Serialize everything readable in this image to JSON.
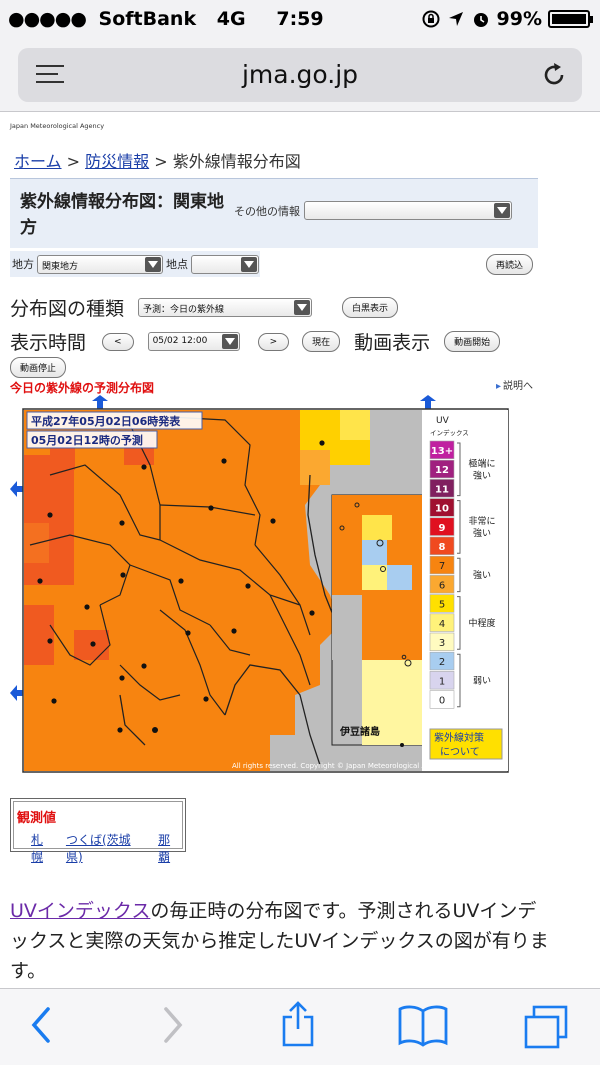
{
  "status": {
    "carrier": "SoftBank",
    "network": "4G",
    "time": "7:59",
    "battery_pct": "99%",
    "battery_fill": 0.99
  },
  "browser": {
    "host": "jma.go.jp"
  },
  "page": {
    "agency": "Japan Meteorological Agency",
    "breadcrumb": {
      "home": "ホーム",
      "sep1": " > ",
      "disaster": "防災情報",
      "sep2": " > ",
      "current": "紫外線情報分布図"
    },
    "title": "紫外線情報分布図：関東地方",
    "other_info_label": "その他の情報",
    "other_info_value": "",
    "region_label": "地方",
    "region_value": "関東地方",
    "point_label": "地点",
    "point_value": "",
    "reread": "再読込",
    "map_type_label": "分布図の種類",
    "map_type_value": "予測：今日の紫外線",
    "bw": "白黒表示",
    "time_label": "表示時間",
    "prev": "<",
    "time_value": "05/02 12:00",
    "next": ">",
    "now": "現在",
    "anim_label": "動画表示",
    "anim_start": "動画開始",
    "anim_stop": "動画停止",
    "map_title": "今日の紫外線の予測分布図",
    "explain": "説明へ",
    "map": {
      "issued": "平成27年05月02日06時発表",
      "forecast": "05月02日12時の予測",
      "islands": "伊豆諸島",
      "copyright": "All rights reserved. Copyright © Japan Meteorological Agency",
      "legend_title": "UV",
      "legend_sub": "インデックス",
      "legend": [
        {
          "label": "13+",
          "color": "#c020a0"
        },
        {
          "label": "12",
          "color": "#a0207f"
        },
        {
          "label": "11",
          "color": "#80205f"
        },
        {
          "label": "10",
          "color": "#a01030"
        },
        {
          "label": "9",
          "color": "#e01020"
        },
        {
          "label": "8",
          "color": "#f04a20"
        },
        {
          "label": "7",
          "color": "#f78410"
        },
        {
          "label": "6",
          "color": "#fba830"
        },
        {
          "label": "5",
          "color": "#ffe000"
        },
        {
          "label": "4",
          "color": "#fff27a"
        },
        {
          "label": "3",
          "color": "#fffbc0"
        },
        {
          "label": "2",
          "color": "#a8cdf0"
        },
        {
          "label": "1",
          "color": "#d8d4ee"
        },
        {
          "label": "0",
          "color": "#ffffff"
        }
      ],
      "categories": [
        "極端に強い",
        "非常に強い",
        "強い",
        "中程度",
        "弱い"
      ],
      "measures_line1": "紫外線対策",
      "measures_line2": "について"
    },
    "obs_title": "観測値",
    "obs_links": [
      "札幌",
      "つくば(茨城県)",
      "那覇"
    ],
    "desc_link": "UVインデックス",
    "desc_text": "の毎正時の分布図です。予測されるUVインデックスと実際の天気から推定したUVインデックスの図が有ります。"
  },
  "colors": {
    "link": "#1a3ea8",
    "accent_red": "#e01010",
    "uv_orange": "#f78410",
    "toolbar_blue": "#1a7cf0"
  }
}
